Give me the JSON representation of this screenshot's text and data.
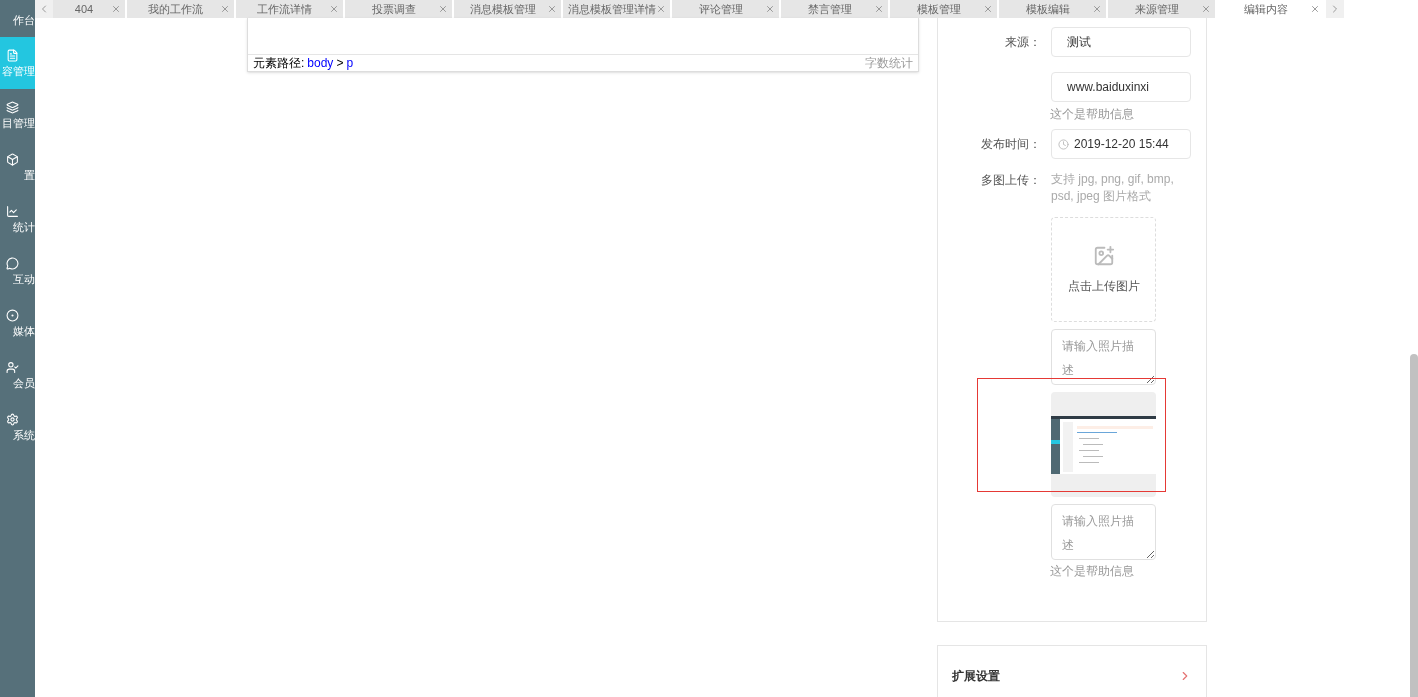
{
  "sidebar": {
    "items": [
      {
        "label": "作台",
        "selected": false
      },
      {
        "label": "容管理",
        "selected": true
      },
      {
        "label": "目管理",
        "selected": false
      },
      {
        "label": "置",
        "selected": false
      },
      {
        "label": "统计",
        "selected": false
      },
      {
        "label": "互动",
        "selected": false
      },
      {
        "label": "媒体",
        "selected": false
      },
      {
        "label": "会员",
        "selected": false
      },
      {
        "label": "系统",
        "selected": false
      }
    ]
  },
  "tabs": [
    {
      "label": "404",
      "selected": false
    },
    {
      "label": "我的工作流",
      "selected": false
    },
    {
      "label": "工作流详情",
      "selected": false
    },
    {
      "label": "投票调查",
      "selected": false
    },
    {
      "label": "消息模板管理",
      "selected": false
    },
    {
      "label": "消息模板管理详情",
      "selected": false
    },
    {
      "label": "评论管理",
      "selected": false
    },
    {
      "label": "禁言管理",
      "selected": false
    },
    {
      "label": "模板管理",
      "selected": false
    },
    {
      "label": "模板编辑",
      "selected": false
    },
    {
      "label": "来源管理",
      "selected": false
    },
    {
      "label": "编辑内容",
      "selected": true
    }
  ],
  "editor": {
    "path_label": "元素路径:",
    "path": [
      "body",
      "p"
    ],
    "path_separator": ">",
    "word_count": "字数统计"
  },
  "form": {
    "source_label": "来源：",
    "source_value": "测试",
    "url_value": "www.baiduxinxi",
    "url_help": "这个是帮助信息",
    "time_label": "发布时间：",
    "time_value": "2019-12-20 15:44",
    "upload_label": "多图上传：",
    "upload_hint": "支持 jpg, png, gif, bmp, psd, jpeg 图片格式",
    "upload_button": "点击上传图片",
    "photos": [
      {
        "kind": "empty",
        "placeholder": "请输入照片描述"
      },
      {
        "kind": "image",
        "placeholder": "请输入照片描述",
        "highlighted": true
      }
    ],
    "help": "这个是帮助信息"
  },
  "extension": {
    "title": "扩展设置"
  }
}
